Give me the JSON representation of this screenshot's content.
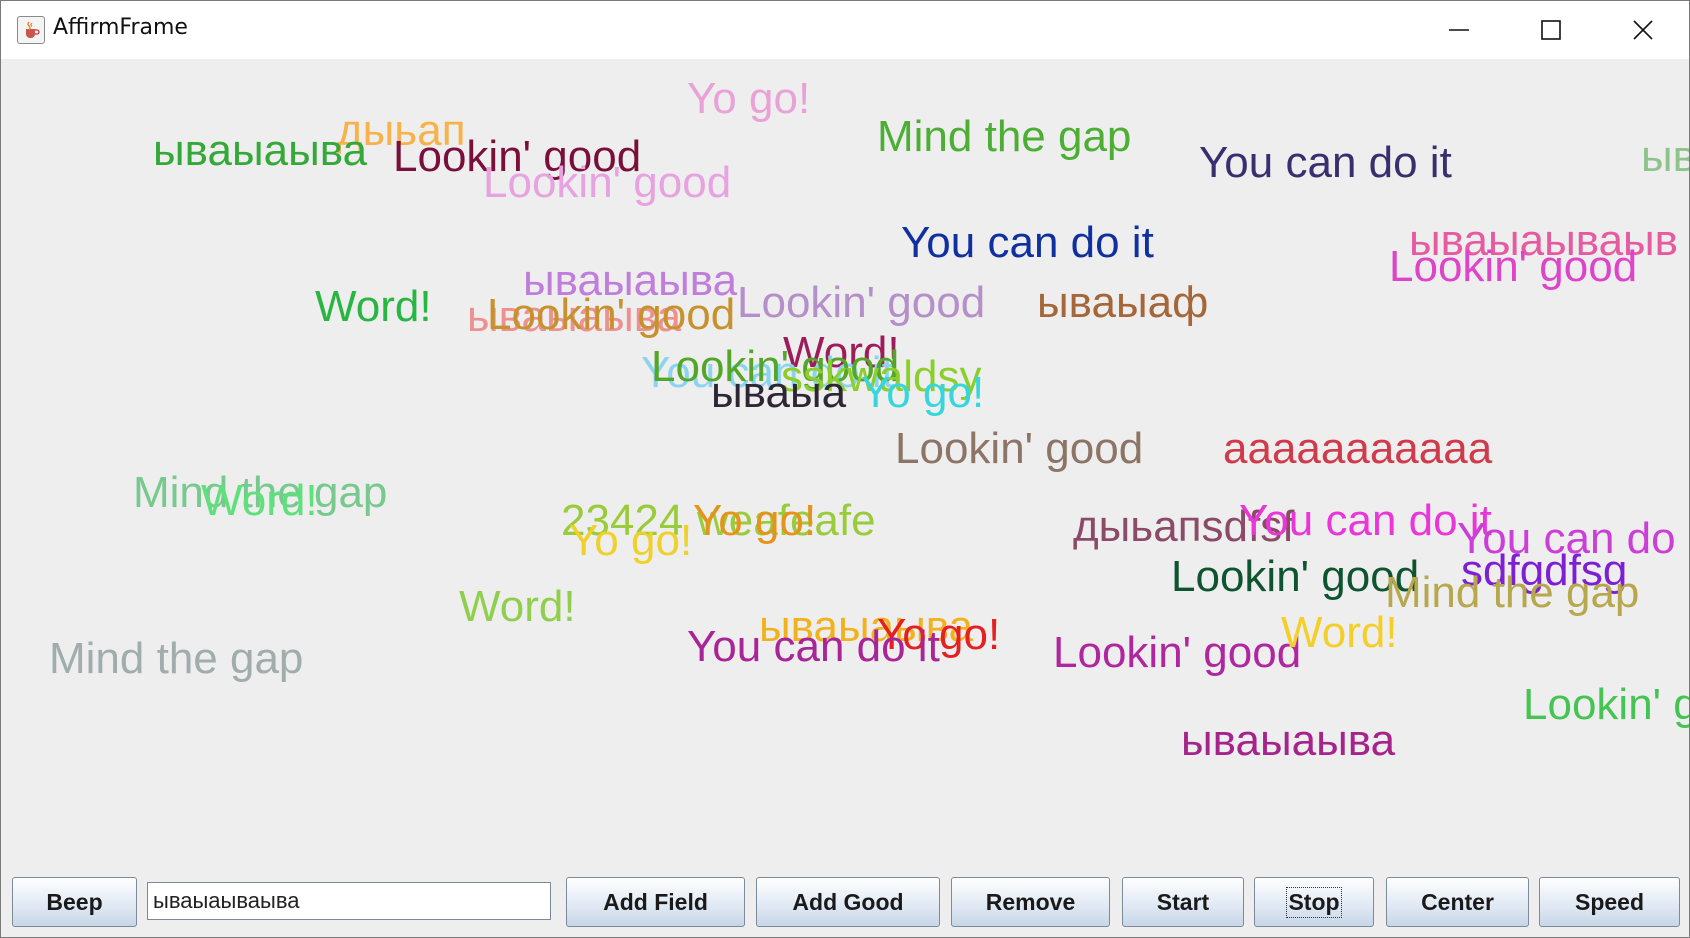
{
  "window": {
    "title": "AffirmFrame",
    "app_icon": "java-cup-icon",
    "controls": [
      "minimize-icon",
      "maximize-icon",
      "close-icon"
    ]
  },
  "canvas": {
    "words": [
      {
        "text": "Yo go!",
        "color": "#e9a2d8"
      },
      {
        "text": "дыьап",
        "color": "#f7b24a"
      },
      {
        "text": "ываыаыва",
        "color": "#34a839"
      },
      {
        "text": "Lookin' good",
        "color": "#7a0f3c"
      },
      {
        "text": "Lookin' good",
        "color": "#e7a2e0"
      },
      {
        "text": "Mind the gap",
        "color": "#4caf33"
      },
      {
        "text": "You can do it",
        "color": "#3a2f6e"
      },
      {
        "text": "ыв",
        "color": "#8ec48c"
      },
      {
        "text": "You can do it",
        "color": "#1030a0"
      },
      {
        "text": "ываыаываыв",
        "color": "#e65aa0"
      },
      {
        "text": "Lookin' good",
        "color": "#dd44c9"
      },
      {
        "text": "ываыаыва",
        "color": "#c07ddc"
      },
      {
        "text": "Word!",
        "color": "#29b542"
      },
      {
        "text": "ываыаыва",
        "color": "#ec9090"
      },
      {
        "text": "Lookin' good",
        "color": "#c7922e"
      },
      {
        "text": "Lookin' good",
        "color": "#b58fc9"
      },
      {
        "text": "ываыаф",
        "color": "#a5673a"
      },
      {
        "text": "Word!",
        "color": "#9e1c5a"
      },
      {
        "text": "You can do it",
        "color": "#8ad4f0"
      },
      {
        "text": "Lookin' good",
        "color": "#53a628"
      },
      {
        "text": "sskwaldsy",
        "color": "#8bcf2e"
      },
      {
        "text": "Yo go!",
        "color": "#35d7dc"
      },
      {
        "text": "ываыа",
        "color": "#2e2535"
      },
      {
        "text": "Lookin' good",
        "color": "#8c7466"
      },
      {
        "text": "ааааааааааа",
        "color": "#d03b4b"
      },
      {
        "text": "Mind the gap",
        "color": "#77c98d"
      },
      {
        "text": "Word!",
        "color": "#5ee07b"
      },
      {
        "text": "23424",
        "color": "#9acb3b"
      },
      {
        "text": "weafeafe",
        "color": "#9acb3b"
      },
      {
        "text": "Yo go!",
        "color": "#e6931c"
      },
      {
        "text": "Yo go!",
        "color": "#f0d02a"
      },
      {
        "text": "дыьапsdfsf",
        "color": "#8a4a68"
      },
      {
        "text": "You can do it",
        "color": "#ea35d8"
      },
      {
        "text": "You can do",
        "color": "#cc3fd6"
      },
      {
        "text": "Lookin' good",
        "color": "#0e5430"
      },
      {
        "text": "sdfgdfsg",
        "color": "#7e1fd4"
      },
      {
        "text": "Mind the gap",
        "color": "#b7a74d"
      },
      {
        "text": "Word!",
        "color": "#8fcf4d"
      },
      {
        "text": "ываыаыва",
        "color": "#f2b21e"
      },
      {
        "text": "Yo go!",
        "color": "#e62020"
      },
      {
        "text": "You can do it",
        "color": "#a82497"
      },
      {
        "text": "Lookin' good",
        "color": "#b0269f"
      },
      {
        "text": "Word!",
        "color": "#f4cf2a"
      },
      {
        "text": "Mind the gap",
        "color": "#a1acac"
      },
      {
        "text": "Lookin' good",
        "color": "#45c453"
      },
      {
        "text": "ываыаыва",
        "color": "#a6238c"
      }
    ]
  },
  "controls": {
    "beep": "Beep",
    "input_value": "ываыаываыва",
    "add_field": "Add Field",
    "add_good": "Add Good",
    "remove": "Remove",
    "start": "Start",
    "stop": "Stop",
    "center": "Center",
    "speed": "Speed"
  }
}
